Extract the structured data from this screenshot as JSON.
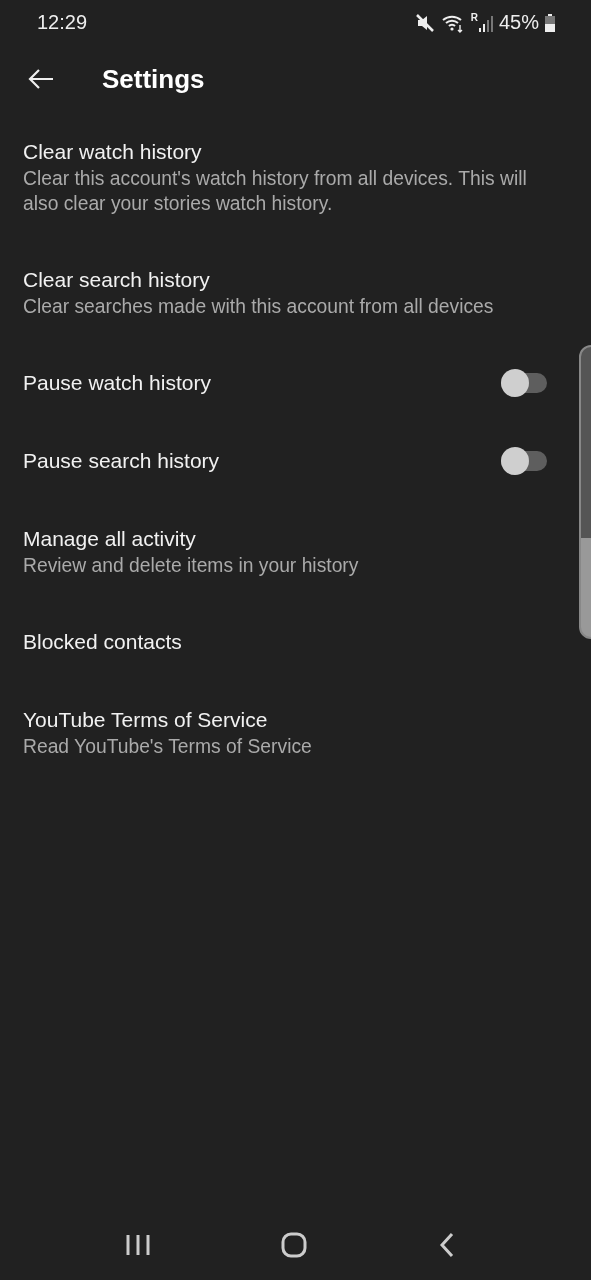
{
  "status_bar": {
    "time": "12:29",
    "network_label": "R",
    "battery": "45%"
  },
  "header": {
    "title": "Settings"
  },
  "items": [
    {
      "kind": "text",
      "title": "Clear watch history",
      "subtitle": "Clear this account's watch history from all devices. This will also clear your stories watch history."
    },
    {
      "kind": "text",
      "title": "Clear search history",
      "subtitle": "Clear searches made with this account from all devices"
    },
    {
      "kind": "toggle",
      "title": "Pause watch history",
      "on": false
    },
    {
      "kind": "toggle",
      "title": "Pause search history",
      "on": false
    },
    {
      "kind": "text",
      "title": "Manage all activity",
      "subtitle": "Review and delete items in your history"
    },
    {
      "kind": "text",
      "title": "Blocked contacts"
    },
    {
      "kind": "text",
      "title": "YouTube Terms of Service",
      "subtitle": "Read YouTube's Terms of Service"
    }
  ]
}
